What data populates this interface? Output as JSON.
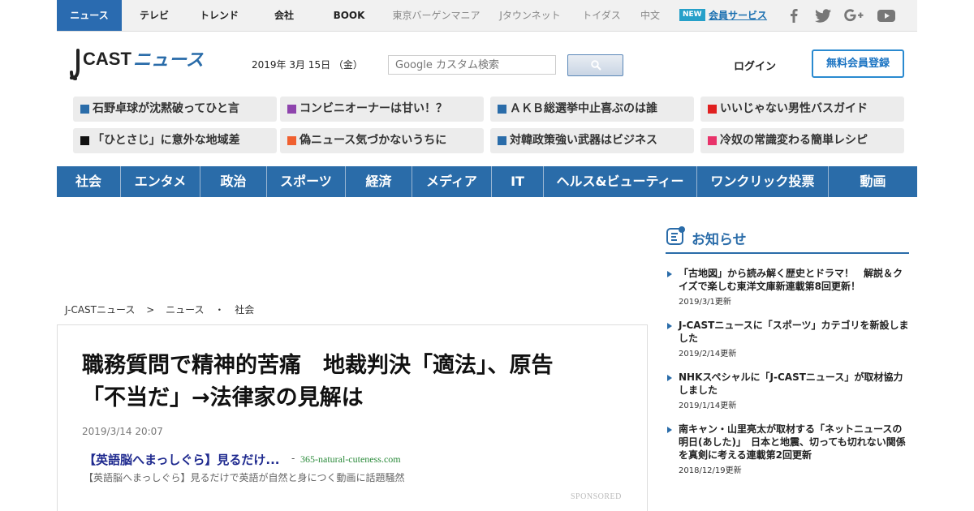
{
  "topbar": {
    "items": [
      "ニュース",
      "テレビ",
      "トレンド",
      "会社",
      "BOOK",
      "東京バーゲンマニア",
      "Jタウンネット",
      "トイダス",
      "中文"
    ],
    "new_badge": "NEW",
    "member_link": "会員サービス",
    "social_icons": [
      "facebook-icon",
      "twitter-icon",
      "google-plus-icon",
      "youtube-icon"
    ]
  },
  "header": {
    "logo_j": "J",
    "logo_cast": "CAST",
    "logo_news": "ニュース",
    "date": "2019年 3月 15日 （金）",
    "search_placeholder": "Google カスタム検索",
    "login": "ログイン",
    "register": "無料会員登録"
  },
  "topics": [
    {
      "label": "石野卓球が沈黙破ってひと言",
      "color": "#2a6ca9"
    },
    {
      "label": "コンビニオーナーは甘い！？",
      "color": "#8e44ad"
    },
    {
      "label": "ＡＫＢ総選挙中止喜ぶのは誰",
      "color": "#2a6ca9"
    },
    {
      "label": "いいじゃない男性バスガイド",
      "color": "#e02020"
    },
    {
      "label": "「ひとさじ」に意外な地域差",
      "color": "#111111"
    },
    {
      "label": "偽ニュース気づかないうちに",
      "color": "#f06030"
    },
    {
      "label": "対韓政策強い武器はビジネス",
      "color": "#2a6ca9"
    },
    {
      "label": "冷奴の常識変わる簡単レシピ",
      "color": "#e8336a"
    }
  ],
  "categories": [
    "社会",
    "エンタメ",
    "政治",
    "スポーツ",
    "経済",
    "メディア",
    "IT",
    "ヘルス&ビューティー",
    "ワンクリック投票",
    "動画"
  ],
  "breadcrumb": {
    "home": "J-CASTニュース",
    "sep1": ">",
    "section": "ニュース",
    "sep2": "・",
    "category": "社会"
  },
  "article": {
    "headline_line1": "職務質問で精神的苦痛　地裁判決「適法」、原告",
    "headline_line2": "「不当だ」→法律家の見解は",
    "date": "2019/3/14 20:07",
    "ad": {
      "title": "【英語脳へまっしぐら】見るだけ...",
      "sep": "-",
      "domain": "365-natural-cuteness.com",
      "desc": "【英語脳へまっしぐら】見るだけで英語が自然と身につく動画に話題騒然",
      "sponsored": "SPONSORED"
    }
  },
  "sidebar": {
    "title": "お知らせ",
    "notices": [
      {
        "lines": [
          "「古地図」から読み解く歴史とドラマ！　解説＆ク",
          "イズで楽しむ東洋文庫新連載第8回更新！"
        ],
        "date": "2019/3/1更新"
      },
      {
        "lines": [
          "J-CASTニュースに「スポーツ」カテゴリを新設しま",
          "した"
        ],
        "date": "2019/2/14更新"
      },
      {
        "lines": [
          "NHKスペシャルに「J-CASTニュース」が取材協力",
          "しました"
        ],
        "date": "2019/1/14更新"
      },
      {
        "lines": [
          "南キャン・山里亮太が取材する「ネットニュースの",
          "明日(あした)」　日本と地震、切っても切れない関係",
          "を真剣に考える連載第2回更新"
        ],
        "date": "2018/12/19更新"
      }
    ]
  },
  "colors": {
    "brand_blue": "#2a6ca9",
    "new_badge": "#26a0c9",
    "ad_title": "#1f2a8f",
    "ad_domain": "#2a8a3a"
  }
}
